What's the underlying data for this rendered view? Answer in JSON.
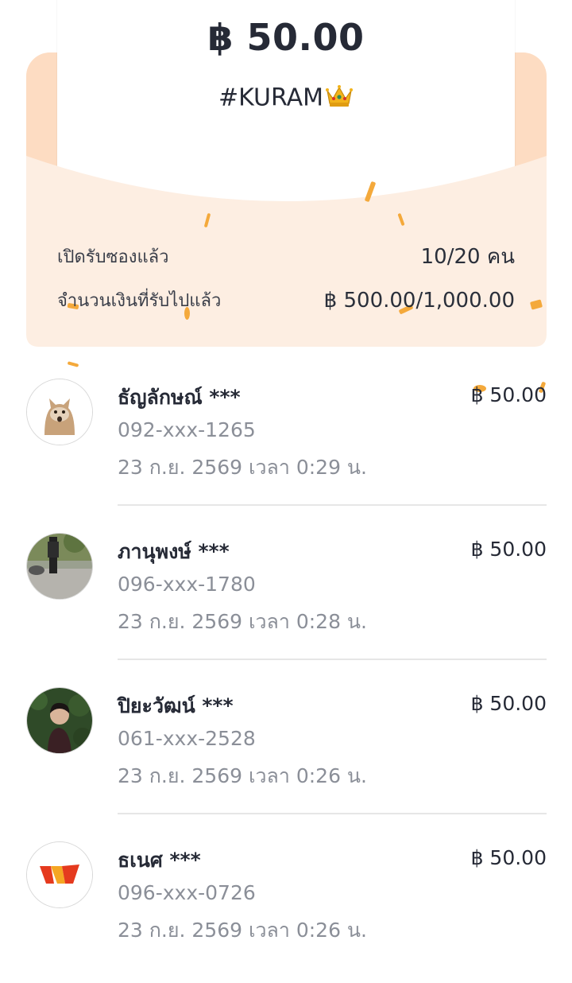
{
  "envelope": {
    "amount": "฿ 50.00",
    "code": "#KURAM"
  },
  "stats": {
    "opened_label": "เปิดรับซองแล้ว",
    "opened_value": "10/20 คน",
    "received_label": "จำนวนเงินที่รับไปแล้ว",
    "received_value": "฿ 500.00/1,000.00"
  },
  "colors": {
    "envelope_bg": "#fdeee2",
    "confetti": "#f4a93b",
    "muted_text": "#8b8f98"
  },
  "recipients": [
    {
      "name": "ธัญลักษณ์ ***",
      "phone": "092-xxx-1265",
      "time": "23 ก.ย. 2569 เวลา 0:29 น.",
      "amount": "฿ 50.00",
      "avatar": "cat-avatar"
    },
    {
      "name": "ภานุพงษ์ ***",
      "phone": "096-xxx-1780",
      "time": "23 ก.ย. 2569 เวลา 0:28 น.",
      "amount": "฿ 50.00",
      "avatar": "photo-avatar"
    },
    {
      "name": "ปิยะวัฒน์ ***",
      "phone": "061-xxx-2528",
      "time": "23 ก.ย. 2569 เวลา 0:26 น.",
      "amount": "฿ 50.00",
      "avatar": "person-avatar"
    },
    {
      "name": "ธเนศ ***",
      "phone": "096-xxx-0726",
      "time": "23 ก.ย. 2569 เวลา 0:26 น.",
      "amount": "฿ 50.00",
      "avatar": "logo-avatar"
    }
  ]
}
